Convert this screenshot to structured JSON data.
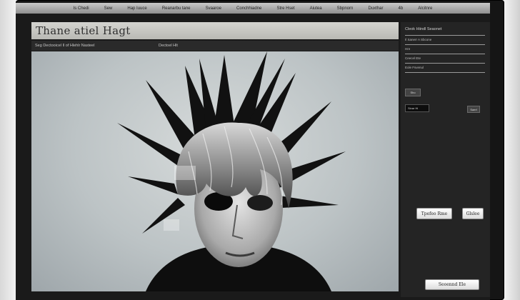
{
  "nav": {
    "items": [
      "Is Chedi",
      "Sew",
      "Hap Iuuce",
      "Reanarbu tane",
      "Svaaroe",
      "Conchhiadne",
      "Stre Hset",
      "Aiutea",
      "Sbpnorn",
      "Duxthar",
      "4b",
      "Alcitnre"
    ]
  },
  "page": {
    "title": "Thane atiel Hagt",
    "subtitle_left": "Seg Dectooicel Il of Hlehlr Nasteel",
    "subtitle_right": "Dectoel Hlt"
  },
  "sidebar": {
    "heading": "Cleok Hiindl Seaonet",
    "lines": [
      "Il Sanerr A Sbcone",
      "Hre",
      "Ceecel Ete",
      "Eole Fsvenul"
    ],
    "small_button": "Sho",
    "field_value": "Sinar Hi",
    "field_button": "Saerl",
    "button_primary": "Tpefeo Rme",
    "button_secondary": "Glslee",
    "footer_button": "Seoennd Ele"
  },
  "colors": {
    "background": "#151515",
    "title_bar": "#cfcfca",
    "sidebar": "#242424"
  }
}
